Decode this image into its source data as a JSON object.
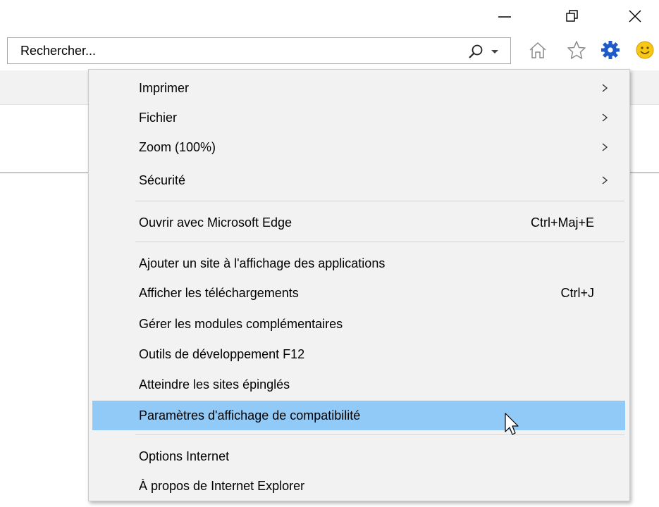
{
  "search": {
    "placeholder": "Rechercher..."
  },
  "toolbar": {
    "icons": [
      "home-icon",
      "star-icon",
      "gear-icon",
      "smiley-icon"
    ],
    "gear_color": "#1e5ac8",
    "smiley_color": "#f7c716"
  },
  "menu": {
    "highlight_color": "#91c9f7",
    "items": [
      {
        "label": "Imprimer",
        "submenu": true
      },
      {
        "label": "Fichier",
        "submenu": true
      },
      {
        "label": "Zoom (100%)",
        "submenu": true
      },
      {
        "label": "Sécurité",
        "submenu": true
      },
      {
        "label": "Ouvrir avec Microsoft Edge",
        "shortcut": "Ctrl+Maj+E"
      },
      {
        "label": "Ajouter un site à l'affichage des applications"
      },
      {
        "label": "Afficher les téléchargements",
        "shortcut": "Ctrl+J"
      },
      {
        "label": "Gérer les modules complémentaires"
      },
      {
        "label": "Outils de développement F12"
      },
      {
        "label": "Atteindre les sites épinglés"
      },
      {
        "label": "Paramètres d'affichage de compatibilité",
        "highlighted": true
      },
      {
        "label": "Options Internet"
      },
      {
        "label": "À propos de Internet Explorer"
      }
    ]
  }
}
